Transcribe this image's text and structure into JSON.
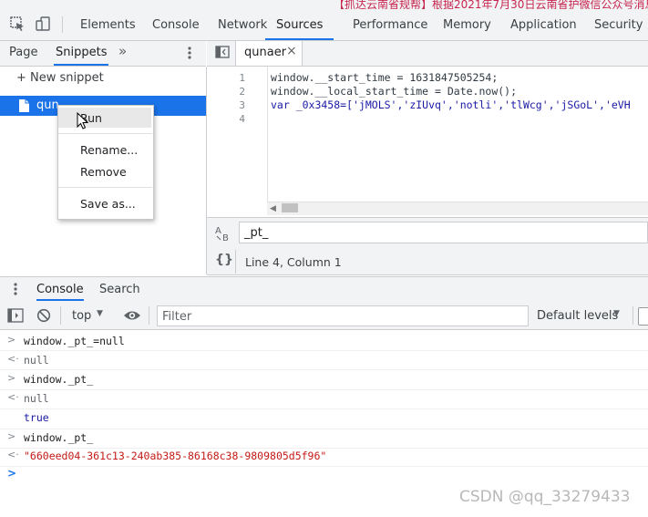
{
  "page_header_text": "【抓达云南省规帮】根据2021年7月30日云南省护微信公众号消息",
  "toolbar_tabs": [
    "Elements",
    "Console",
    "Network",
    "Sources",
    "Performance",
    "Memory",
    "Application",
    "Security"
  ],
  "active_tab": "Sources",
  "navigator": {
    "tabs": [
      "Page",
      "Snippets"
    ],
    "more": "»",
    "new_snippet": "+ New snippet",
    "snippet_name": "qunaer",
    "snippet_visible": "qun"
  },
  "context_menu": {
    "items": [
      "Run",
      "Rename...",
      "Remove",
      "Save as..."
    ]
  },
  "editor": {
    "tab_name": "qunaer",
    "close": "×",
    "lines": [
      {
        "num": "1",
        "text": "window.__start_time = 1631847505254;"
      },
      {
        "num": "2",
        "text": "window.__local_start_time = Date.now();"
      },
      {
        "num": "3",
        "text": "var _0x3458=['jMOLS','zIUvq','notli','tlWcg','jSGoL','eVH"
      },
      {
        "num": "4",
        "text": ""
      }
    ],
    "search_value": "_pt_",
    "status": "Line 4, Column 1",
    "braces": "{}"
  },
  "drawer": {
    "tabs": [
      "Console",
      "Search"
    ],
    "context": "top",
    "filter_placeholder": "Filter",
    "levels": "Default levels"
  },
  "console": [
    {
      "kind": "input",
      "text": "window._pt_=null"
    },
    {
      "kind": "result",
      "text": "null"
    },
    {
      "kind": "input",
      "text": "window._pt_"
    },
    {
      "kind": "result",
      "text": "null"
    },
    {
      "kind": "result",
      "text": "true"
    },
    {
      "kind": "input",
      "text": "window._pt_"
    },
    {
      "kind": "result",
      "text": "\"660eed04-361c13-240ab385-86168c38-9809805d5f96\""
    }
  ],
  "watermark": "CSDN @qq_33279433",
  "colors": {
    "accent": "#1a73e8",
    "string_red": "#c41a16",
    "keyword_blue": "#1a1aa6"
  }
}
